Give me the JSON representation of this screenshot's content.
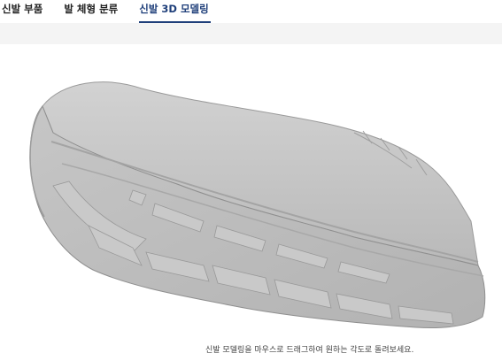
{
  "tabs": [
    {
      "label": "신발 부품",
      "active": false
    },
    {
      "label": "발 체형 분류",
      "active": false
    },
    {
      "label": "신발 3D 모델링",
      "active": true
    }
  ],
  "viewer": {
    "hint": "신발 모델링을 마우스로 드래그하여 원하는 각도로 돌려보세요.",
    "model": "shoe-3d-model",
    "colors": {
      "accent": "#1f3f7a",
      "model": "#bdbdbd",
      "band": "#f4f4f4"
    }
  }
}
